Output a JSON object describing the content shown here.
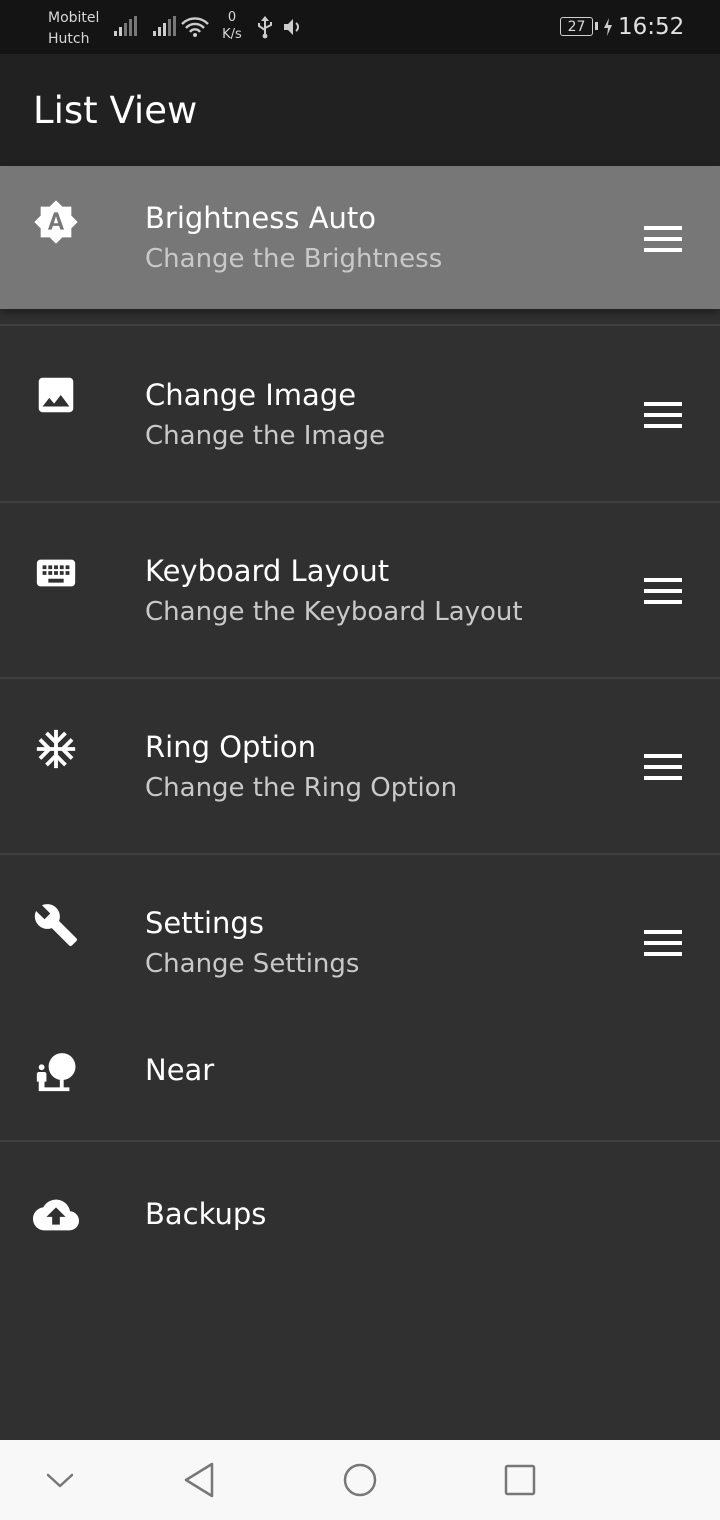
{
  "status": {
    "carrier_line1": "Mobitel",
    "carrier_line2": "Hutch",
    "speed_value": "0",
    "speed_unit": "K/s",
    "battery": "27",
    "time": "16:52"
  },
  "app_bar": {
    "title": "List View"
  },
  "items": [
    {
      "title": "Brightness Auto",
      "subtitle": "Change the Brightness",
      "icon": "brightness-auto-icon"
    },
    {
      "title": "Change Image",
      "subtitle": "Change the Image",
      "icon": "image-icon"
    },
    {
      "title": "Keyboard Layout",
      "subtitle": "Change the Keyboard Layout",
      "icon": "keyboard-icon"
    },
    {
      "title": "Ring Option",
      "subtitle": "Change the Ring Option",
      "icon": "snowflake-icon"
    },
    {
      "title": "Settings",
      "subtitle": "Change Settings",
      "icon": "wrench-icon"
    },
    {
      "title": "Near",
      "icon": "nature-people-icon"
    },
    {
      "title": "Backups",
      "icon": "cloud-upload-icon"
    }
  ],
  "colors": {
    "background": "#303030",
    "app_bar": "#212121",
    "dragged_item": "#777777",
    "nav_bar": "#f8f8f8"
  }
}
